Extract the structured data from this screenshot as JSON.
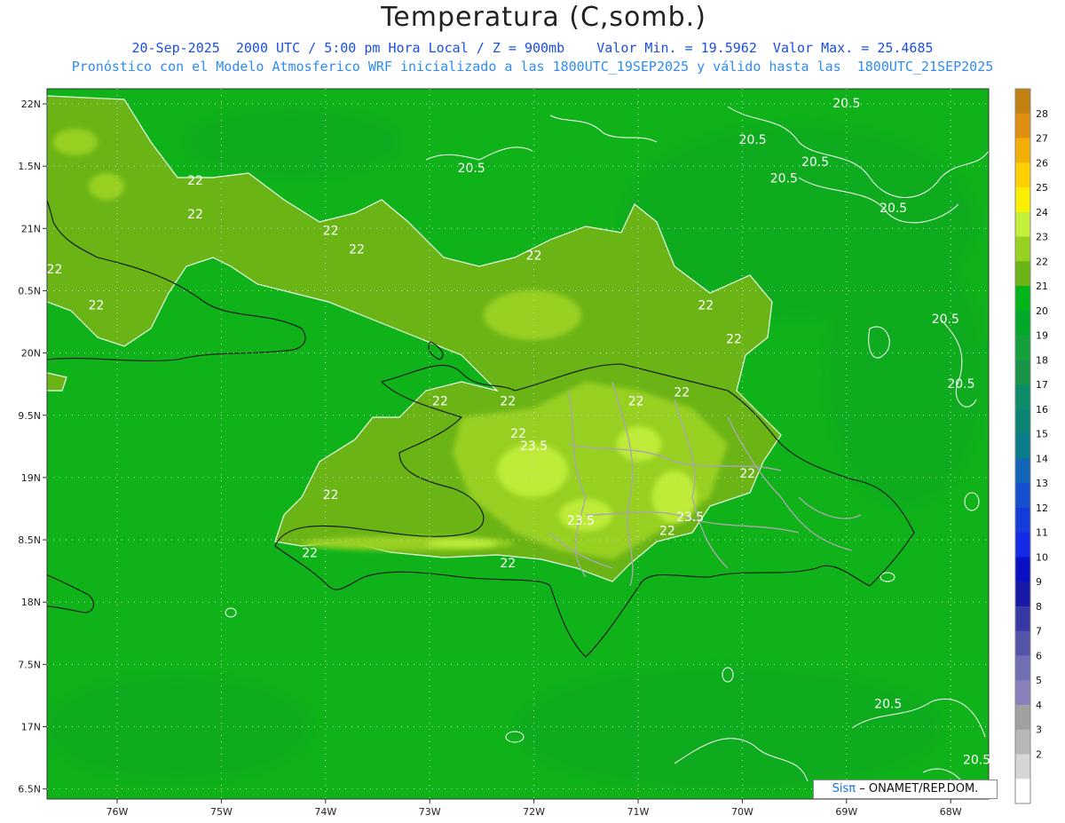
{
  "title": "Temperatura (C,somb.)",
  "subtitle1": "20-Sep-2025  2000 UTC / 5:00 pm Hora Local / Z = 900mb    Valor Min. = 19.5962  Valor Max. = 25.4685",
  "subtitle2": "Pronóstico con el Modelo Atmosferico WRF inicializado a las 1800UTC_19SEP2025 y válido hasta las  1800UTC_21SEP2025",
  "credit_sis": "Sisπ",
  "credit_rest": "– ONAMET/REP.DOM.",
  "map": {
    "lon_ticks": [
      "76W",
      "75W",
      "74W",
      "73W",
      "72W",
      "71W",
      "70W",
      "69W",
      "68W"
    ],
    "lat_ticks": [
      "22N",
      "1.5N",
      "21N",
      "0.5N",
      "20N",
      "9.5N",
      "19N",
      "8.5N",
      "18N",
      "7.5N",
      "17N",
      "6.5N"
    ],
    "contour_labels": [
      {
        "text": "22",
        "lon": -75.25,
        "lat": 21.35
      },
      {
        "text": "22",
        "lon": -75.25,
        "lat": 21.08
      },
      {
        "text": "22",
        "lon": -73.95,
        "lat": 20.95
      },
      {
        "text": "22",
        "lon": -73.7,
        "lat": 20.8
      },
      {
        "text": "22",
        "lon": -72.0,
        "lat": 20.75
      },
      {
        "text": "22",
        "lon": -70.35,
        "lat": 20.35
      },
      {
        "text": "22",
        "lon": -70.08,
        "lat": 20.08
      },
      {
        "text": "22",
        "lon": -76.6,
        "lat": 20.64
      },
      {
        "text": "22",
        "lon": -76.2,
        "lat": 20.35
      },
      {
        "text": "22",
        "lon": -72.9,
        "lat": 19.58
      },
      {
        "text": "22",
        "lon": -72.25,
        "lat": 19.58
      },
      {
        "text": "22",
        "lon": -71.02,
        "lat": 19.58
      },
      {
        "text": "22",
        "lon": -70.58,
        "lat": 19.65
      },
      {
        "text": "22",
        "lon": -72.15,
        "lat": 19.32
      },
      {
        "text": "22",
        "lon": -73.95,
        "lat": 18.83
      },
      {
        "text": "22",
        "lon": -74.15,
        "lat": 18.36
      },
      {
        "text": "22",
        "lon": -72.25,
        "lat": 18.28
      },
      {
        "text": "22",
        "lon": -70.72,
        "lat": 18.54
      },
      {
        "text": "22",
        "lon": -69.95,
        "lat": 19.0
      },
      {
        "text": "23.5",
        "lon": -72.0,
        "lat": 19.22
      },
      {
        "text": "23.5",
        "lon": -71.55,
        "lat": 18.62
      },
      {
        "text": "23.5",
        "lon": -70.5,
        "lat": 18.65
      },
      {
        "text": "20.5",
        "lon": -72.6,
        "lat": 21.45
      },
      {
        "text": "20.5",
        "lon": -69.9,
        "lat": 21.68
      },
      {
        "text": "20.5",
        "lon": -69.3,
        "lat": 21.5
      },
      {
        "text": "20.5",
        "lon": -69.6,
        "lat": 21.37
      },
      {
        "text": "20.5",
        "lon": -68.55,
        "lat": 21.13
      },
      {
        "text": "20.5",
        "lon": -69.0,
        "lat": 21.97
      },
      {
        "text": "20.5",
        "lon": -68.05,
        "lat": 20.24
      },
      {
        "text": "20.5",
        "lon": -67.9,
        "lat": 19.72
      },
      {
        "text": "20.5",
        "lon": -68.6,
        "lat": 17.15
      },
      {
        "text": "20.5",
        "lon": -67.75,
        "lat": 16.7
      }
    ]
  },
  "colorbar": {
    "labels": [
      "28",
      "27",
      "26",
      "25",
      "24",
      "23",
      "22",
      "21",
      "20",
      "19",
      "18",
      "17",
      "16",
      "15",
      "14",
      "13",
      "12",
      "11",
      "10",
      "9",
      "8",
      "7",
      "6",
      "5",
      "4",
      "3",
      "2"
    ],
    "colors": [
      "#c28010",
      "#e08e10",
      "#f4ae08",
      "#fed000",
      "#f8f000",
      "#c4f03c",
      "#98d020",
      "#6ab416",
      "#00b41a",
      "#00a828",
      "#14a03a",
      "#189448",
      "#0c8c68",
      "#0c8474",
      "#0c7c8c",
      "#1464b8",
      "#1450d0",
      "#143cdc",
      "#1428e8",
      "#0a10c4",
      "#1818a8",
      "#3838a4",
      "#5454a8",
      "#7070b4",
      "#8c80bc",
      "#a0a0a0",
      "#b8b8b8",
      "#d6d6d6",
      "#ffffff"
    ]
  }
}
